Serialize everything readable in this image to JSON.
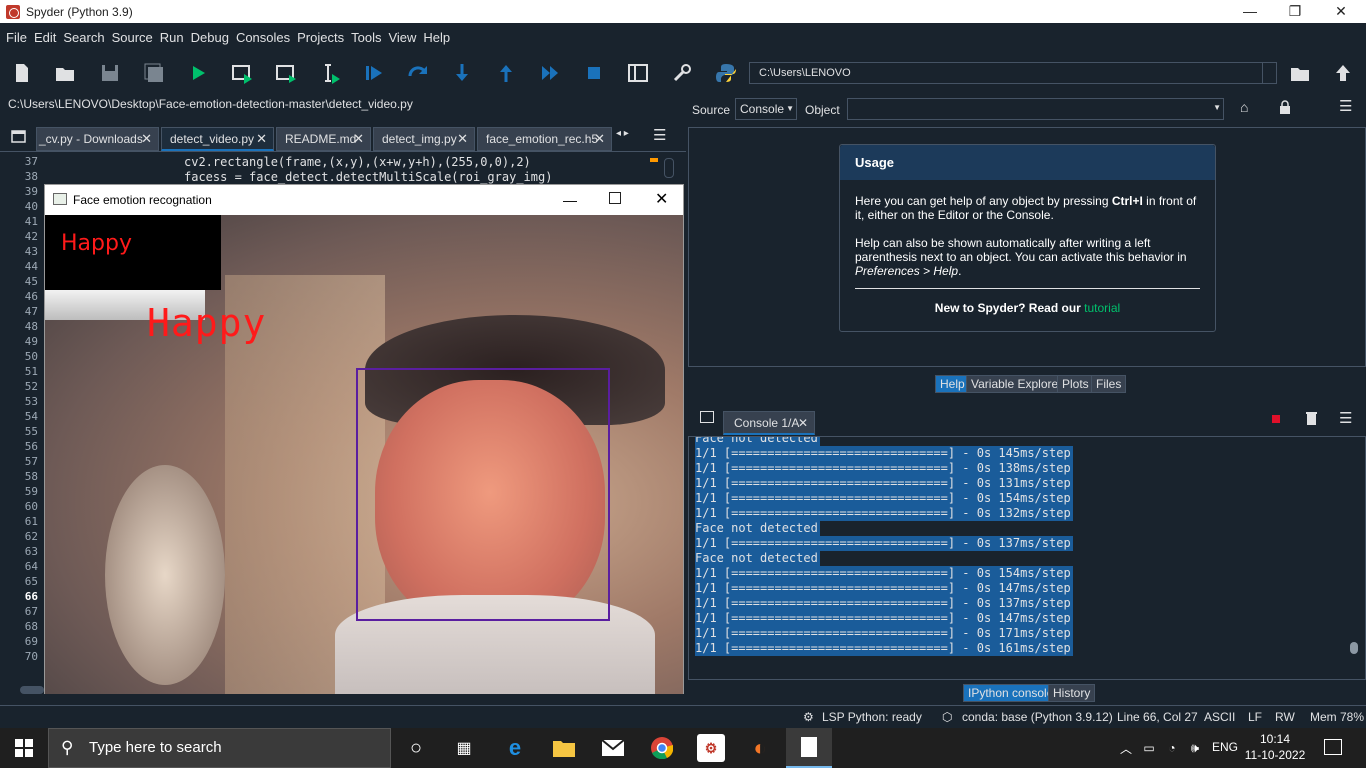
{
  "window": {
    "title": "Spyder (Python 3.9)",
    "controls": [
      "—",
      "❐",
      "✕"
    ]
  },
  "menu": [
    "File",
    "Edit",
    "Search",
    "Source",
    "Run",
    "Debug",
    "Consoles",
    "Projects",
    "Tools",
    "View",
    "Help"
  ],
  "toolbar": {
    "path": "C:\\Users\\LENOVO"
  },
  "editor": {
    "filepath": "C:\\Users\\LENOVO\\Desktop\\Face-emotion-detection-master\\detect_video.py",
    "tabs": [
      "_cv.py - Downloads",
      "detect_video.py",
      "README.md",
      "detect_img.py",
      "face_emotion_rec.h5"
    ],
    "active_tab": 1,
    "line_numbers": [
      "37",
      "38",
      "39",
      "40",
      "41",
      "42",
      "43",
      "44",
      "45",
      "46",
      "47",
      "48",
      "49",
      "50",
      "51",
      "52",
      "53",
      "54",
      "55",
      "56",
      "57",
      "58",
      "59",
      "60",
      "61",
      "62",
      "63",
      "64",
      "65",
      "66",
      "67",
      "68",
      "69",
      "70"
    ],
    "current_line": "66",
    "code_lines": [
      "cv2.rectangle(frame,(x,y),(x+w,y+h),(255,0,0),2)",
      "facess = face_detect.detectMultiScale(roi_gray_img)"
    ]
  },
  "popup": {
    "title": "Face emotion recognation",
    "overlay_label": "Happy",
    "face_label": "Happy"
  },
  "help": {
    "source_label": "Source",
    "source_value": "Console",
    "object_label": "Object",
    "usage_title": "Usage",
    "para1_a": "Here you can get help of any object by pressing ",
    "para1_key": "Ctrl+I",
    "para1_b": " in front of it, either on the Editor or the Console.",
    "para2_a": "Help can also be shown automatically after writing a left parenthesis next to an object. You can activate this behavior in ",
    "para2_pref": "Preferences > Help",
    "para2_b": ".",
    "new_text": "New to Spyder? Read our ",
    "tutorial": "tutorial",
    "tabs": [
      "Help",
      "Variable Explorer",
      "Plots",
      "Files"
    ]
  },
  "console": {
    "tab": "Console 1/A",
    "lines": [
      "Face not detected",
      "1/1 [==============================] - 0s 145ms/step",
      "1/1 [==============================] - 0s 138ms/step",
      "1/1 [==============================] - 0s 131ms/step",
      "1/1 [==============================] - 0s 154ms/step",
      "1/1 [==============================] - 0s 132ms/step",
      "Face not detected",
      "1/1 [==============================] - 0s 137ms/step",
      "Face not detected",
      "1/1 [==============================] - 0s 154ms/step",
      "1/1 [==============================] - 0s 147ms/step",
      "1/1 [==============================] - 0s 137ms/step",
      "1/1 [==============================] - 0s 147ms/step",
      "1/1 [==============================] - 0s 171ms/step",
      "1/1 [==============================] - 0s 161ms/step"
    ],
    "tabs": [
      "IPython console",
      "History"
    ]
  },
  "status": {
    "lsp": "LSP Python: ready",
    "conda": "conda: base (Python 3.9.12)",
    "position": "Line 66, Col 27",
    "encoding": "ASCII",
    "eol": "LF",
    "mode": "RW",
    "mem": "Mem 78%"
  },
  "taskbar": {
    "search_placeholder": "Type here to search",
    "lang": "ENG",
    "time": "10:14",
    "date": "11-10-2022"
  },
  "colors": {
    "accent": "#1a72bb",
    "bg": "#19232d",
    "border": "#455364",
    "tutorial_link": "#00c06c",
    "happy_red": "#ff1a1a",
    "face_box": "#5a1ea0"
  }
}
